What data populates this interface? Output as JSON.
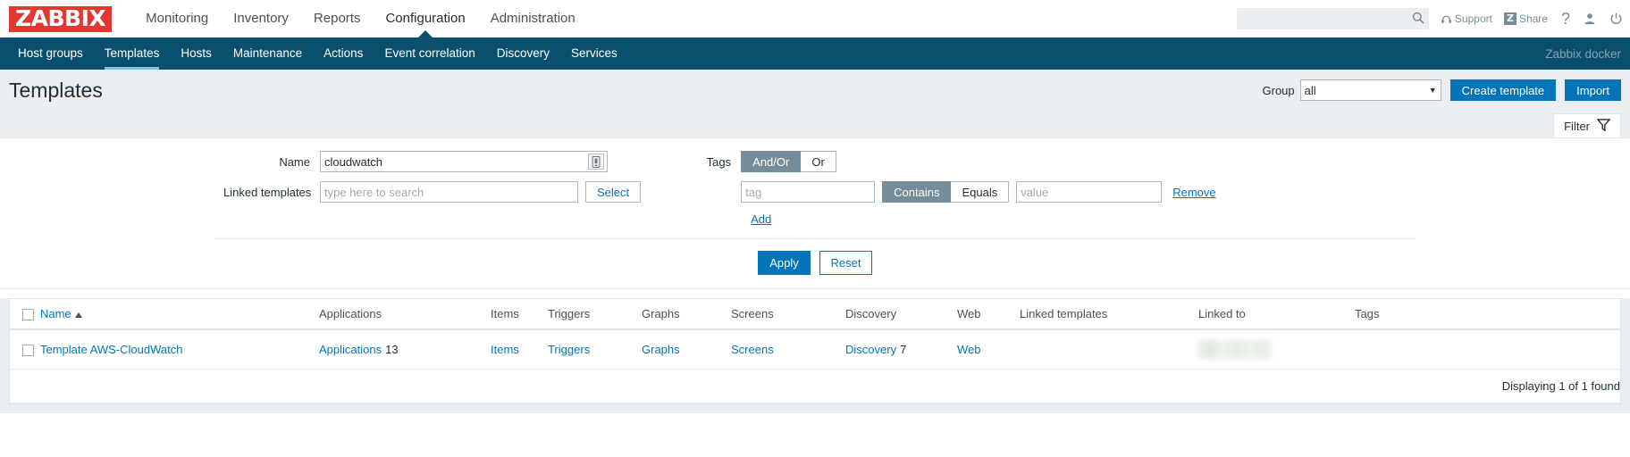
{
  "header": {
    "logo": "ZABBIX",
    "nav": [
      {
        "label": "Monitoring",
        "active": false
      },
      {
        "label": "Inventory",
        "active": false
      },
      {
        "label": "Reports",
        "active": false
      },
      {
        "label": "Configuration",
        "active": true
      },
      {
        "label": "Administration",
        "active": false
      }
    ],
    "search": {
      "value": "",
      "placeholder": ""
    },
    "support_label": "Support",
    "share_label": "Share",
    "share_icon_letter": "Z",
    "help_label": "?",
    "icons": [
      "search-icon",
      "headset-icon",
      "share-z-icon",
      "question-icon",
      "user-icon",
      "power-icon"
    ]
  },
  "subnav": {
    "items": [
      {
        "label": "Host groups",
        "active": false
      },
      {
        "label": "Templates",
        "active": true
      },
      {
        "label": "Hosts",
        "active": false
      },
      {
        "label": "Maintenance",
        "active": false
      },
      {
        "label": "Actions",
        "active": false
      },
      {
        "label": "Event correlation",
        "active": false
      },
      {
        "label": "Discovery",
        "active": false
      },
      {
        "label": "Services",
        "active": false
      }
    ],
    "user": "Zabbix docker"
  },
  "page": {
    "title": "Templates",
    "group_label": "Group",
    "group_value": "all",
    "create_button": "Create template",
    "import_button": "Import"
  },
  "filter": {
    "tab_label": "Filter",
    "name_label": "Name",
    "name_value": "cloudwatch",
    "linked_templates_label": "Linked templates",
    "linked_templates_value": "",
    "linked_templates_placeholder": "type here to search",
    "select_button": "Select",
    "tags_label": "Tags",
    "andor_label": "And/Or",
    "or_label": "Or",
    "operator_selected": "And/Or",
    "tag_value": "",
    "tag_placeholder": "tag",
    "contains_label": "Contains",
    "equals_label": "Equals",
    "match_selected": "Contains",
    "value_value": "",
    "value_placeholder": "value",
    "remove_label": "Remove",
    "add_label": "Add",
    "apply_button": "Apply",
    "reset_button": "Reset"
  },
  "table": {
    "columns": [
      "Name",
      "Applications",
      "Items",
      "Triggers",
      "Graphs",
      "Screens",
      "Discovery",
      "Web",
      "Linked templates",
      "Linked to",
      "Tags"
    ],
    "rows": [
      {
        "name": "Template AWS-CloudWatch",
        "applications": "Applications",
        "applications_count": "13",
        "items": "Items",
        "triggers": "Triggers",
        "graphs": "Graphs",
        "screens": "Screens",
        "discovery": "Discovery",
        "discovery_count": "7",
        "web": "Web",
        "linked_templates": "",
        "linked_to": "",
        "tags": ""
      }
    ],
    "footer": "Displaying 1 of 1 found"
  },
  "colors": {
    "brand_red": "#e33734",
    "nav_blue": "#0b4f6f",
    "link_blue": "#0275b8",
    "accent_underline": "#7ec2ea",
    "toggle_selected": "#768d99",
    "page_bg": "#ebeef0"
  }
}
